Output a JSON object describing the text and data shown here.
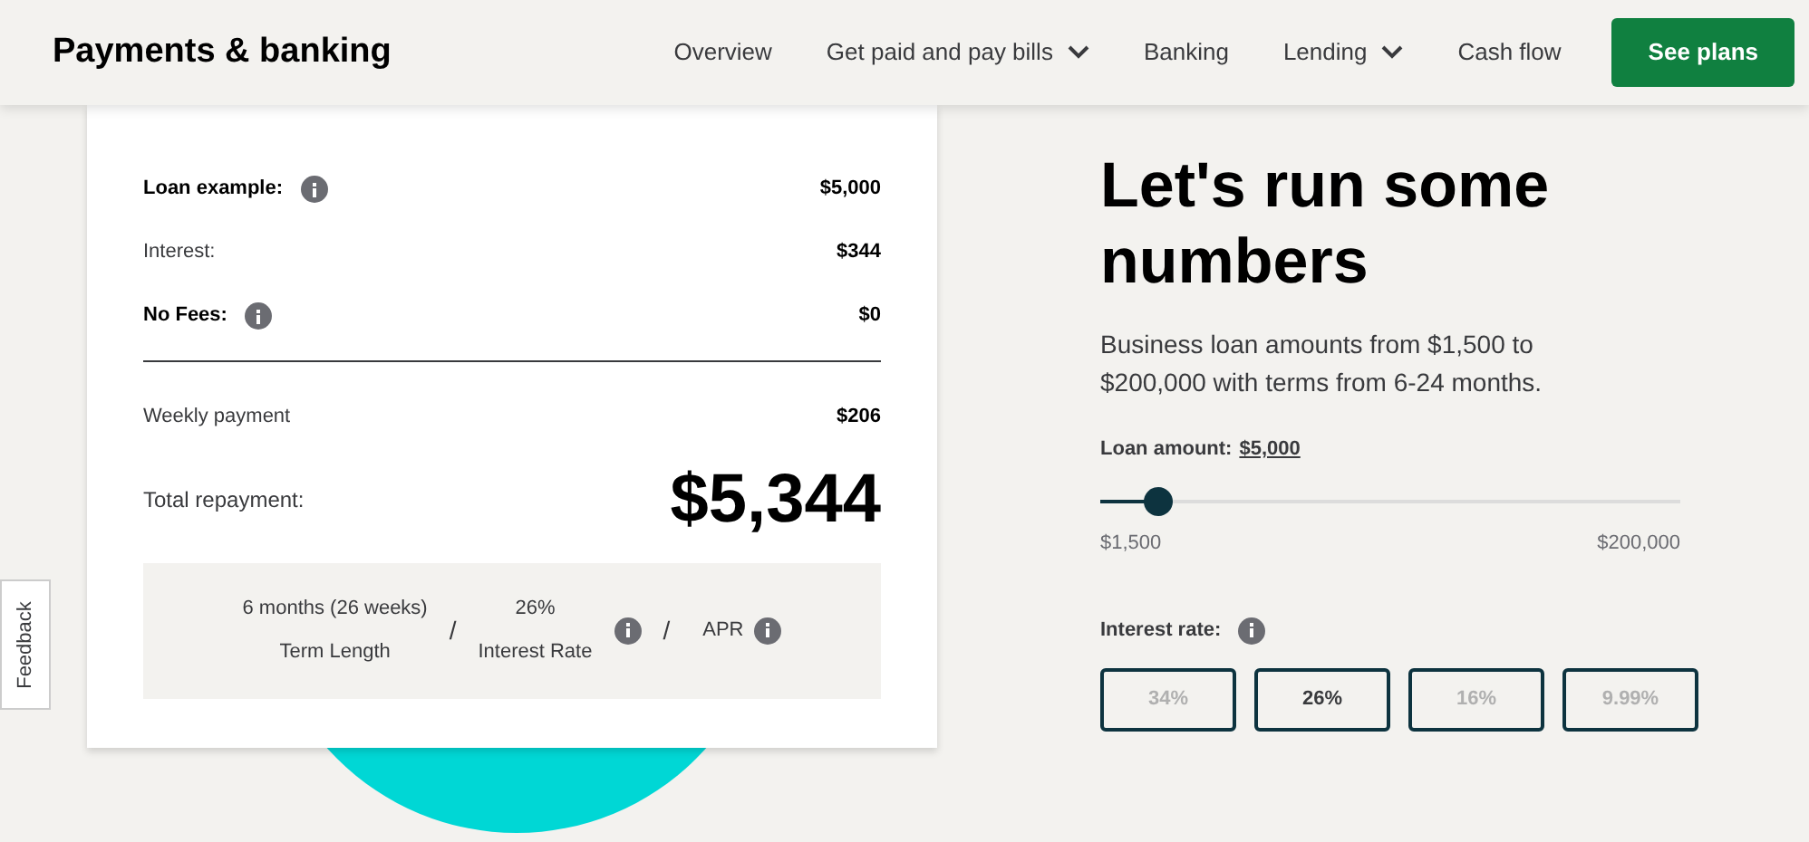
{
  "header": {
    "title": "Payments & banking",
    "nav": [
      {
        "label": "Overview",
        "dropdown": false
      },
      {
        "label": "Get paid and pay bills",
        "dropdown": true
      },
      {
        "label": "Banking",
        "dropdown": false
      },
      {
        "label": "Lending",
        "dropdown": true
      },
      {
        "label": "Cash flow",
        "dropdown": false
      }
    ],
    "cta": "See plans"
  },
  "feedback": "Feedback",
  "card": {
    "rows": [
      {
        "label": "Loan example:",
        "value": "$5,000",
        "strong": true,
        "info": true
      },
      {
        "label": "Interest:",
        "value": "$344",
        "strong": false,
        "info": false
      },
      {
        "label": "No Fees:",
        "value": "$0",
        "strong": true,
        "info": true
      }
    ],
    "weekly": {
      "label": "Weekly payment",
      "value": "$206"
    },
    "total": {
      "label": "Total repayment:",
      "value": "$5,344"
    },
    "terms": {
      "term_value": "6 months (26 weeks)",
      "term_label": "Term Length",
      "sep": "/",
      "rate_value": "26%",
      "rate_label": "Interest Rate",
      "sep2": "/",
      "apr_label": "APR"
    }
  },
  "calculator": {
    "heading": "Let's run some numbers",
    "intro": "Business loan amounts from $1,500 to $200,000 with terms from 6-24 months.",
    "amount_label": "Loan amount:",
    "amount_value": "$5,000",
    "slider": {
      "level": 0.1,
      "min": "$1,500",
      "max": "$200,000"
    },
    "rate_label": "Interest rate:",
    "rates": [
      {
        "label": "34%",
        "selected": false
      },
      {
        "label": "26%",
        "selected": true
      },
      {
        "label": "16%",
        "selected": false
      },
      {
        "label": "9.99%",
        "selected": false
      }
    ]
  }
}
